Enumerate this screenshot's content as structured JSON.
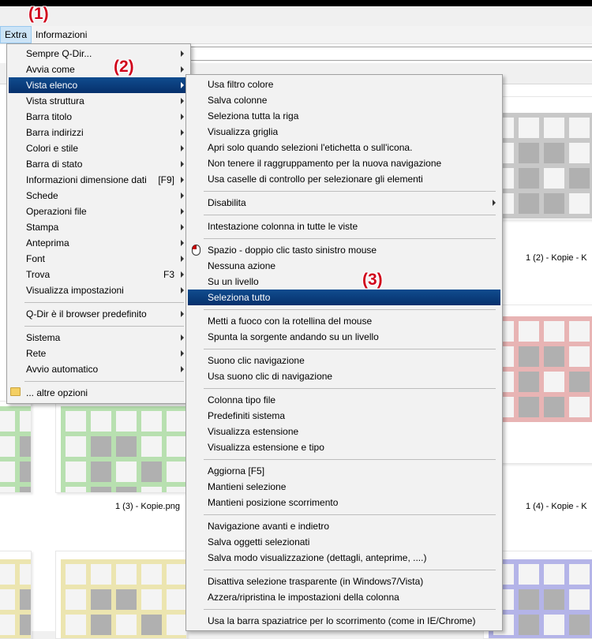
{
  "annotations": {
    "a1": "(1)",
    "a2": "(2)",
    "a3": "(3)"
  },
  "menubar": {
    "extra": "Extra",
    "extra_underline": "x",
    "informazioni": "Informazioni"
  },
  "captions": {
    "c1": "1 (2) - Kopie - K",
    "c2": "1 (3) - Kopie.png",
    "c3": "1 (4) - Kopie - K"
  },
  "colors": {
    "selected_bg": "#0a3a7a",
    "green": "#b8e0b0",
    "gray": "#c8c8c8",
    "red": "#e8b4b4",
    "yellow": "#ece5b0",
    "blue": "#b4b4e8",
    "annotation": "#d0021b"
  },
  "menu": {
    "items": [
      {
        "label": "Sempre Q-Dir...",
        "submenu": true
      },
      {
        "label": "Avvia come",
        "submenu": true
      },
      {
        "label": "Vista elenco",
        "submenu": true,
        "selected": true
      },
      {
        "label": "Vista struttura",
        "submenu": true
      },
      {
        "label": "Barra titolo",
        "submenu": true
      },
      {
        "label": "Barra indirizzi",
        "submenu": true
      },
      {
        "label": "Colori e stile",
        "submenu": true
      },
      {
        "label": "Barra di stato",
        "submenu": true
      },
      {
        "label": "Informazioni dimensione dati",
        "shortcut": "[F9]",
        "submenu": true
      },
      {
        "label": "Schede",
        "submenu": true
      },
      {
        "label": "Operazioni file",
        "submenu": true
      },
      {
        "label": "Stampa",
        "submenu": true
      },
      {
        "label": "Anteprima",
        "submenu": true
      },
      {
        "label": "Font",
        "submenu": true
      },
      {
        "label": "Trova",
        "shortcut": "F3",
        "submenu": true
      },
      {
        "label": "Visualizza impostazioni",
        "submenu": true
      },
      {
        "separator": true
      },
      {
        "label": "Q-Dir è il browser predefinito",
        "submenu": true
      },
      {
        "separator": true
      },
      {
        "label": "Sistema",
        "submenu": true
      },
      {
        "label": "Rete",
        "submenu": true
      },
      {
        "label": "Avvio automatico",
        "submenu": true
      },
      {
        "separator": true
      },
      {
        "label": "... altre opzioni",
        "icon": "folder-icon"
      }
    ]
  },
  "submenu": {
    "items": [
      {
        "label": "Usa filtro colore"
      },
      {
        "label": "Salva colonne"
      },
      {
        "label": "Seleziona tutta la riga"
      },
      {
        "label": "Visualizza griglia"
      },
      {
        "label": "Apri solo quando selezioni l'etichetta o sull'icona."
      },
      {
        "label": "Non tenere il raggruppamento per la nuova navigazione"
      },
      {
        "label": "Usa caselle di controllo per selezionare gli elementi"
      },
      {
        "separator": true
      },
      {
        "label": "Disabilita",
        "submenu": true
      },
      {
        "separator": true
      },
      {
        "label": "Intestazione colonna in tutte le viste"
      },
      {
        "separator": true
      },
      {
        "label": "Spazio - doppio clic tasto sinistro mouse",
        "icon": "mouse-icon"
      },
      {
        "label": "Nessuna azione"
      },
      {
        "label": "Su un livello"
      },
      {
        "label": "Seleziona tutto",
        "selected": true
      },
      {
        "separator": true
      },
      {
        "label": "Metti a fuoco con la rotellina del mouse"
      },
      {
        "label": "Spunta la sorgente andando su un livello"
      },
      {
        "separator": true
      },
      {
        "label": "Suono clic navigazione"
      },
      {
        "label": "Usa suono clic di navigazione"
      },
      {
        "separator": true
      },
      {
        "label": "Colonna tipo file"
      },
      {
        "label": "Predefiniti sistema"
      },
      {
        "label": "Visualizza estensione"
      },
      {
        "label": "Visualizza estensione e tipo"
      },
      {
        "separator": true
      },
      {
        "label": "Aggiorna [F5]"
      },
      {
        "label": "Mantieni selezione"
      },
      {
        "label": "Mantieni posizione scorrimento"
      },
      {
        "separator": true
      },
      {
        "label": "Navigazione avanti e indietro"
      },
      {
        "label": "Salva oggetti selezionati"
      },
      {
        "label": "Salva modo visualizzazione (dettagli, anteprime, ....)"
      },
      {
        "separator": true
      },
      {
        "label": "Disattiva selezione trasparente (in Windows7/Vista)"
      },
      {
        "label": "Azzera/ripristina le impostazioni della colonna"
      },
      {
        "separator": true
      },
      {
        "label": "Usa la barra spaziatrice per lo scorrimento (come in IE/Chrome)"
      }
    ]
  }
}
